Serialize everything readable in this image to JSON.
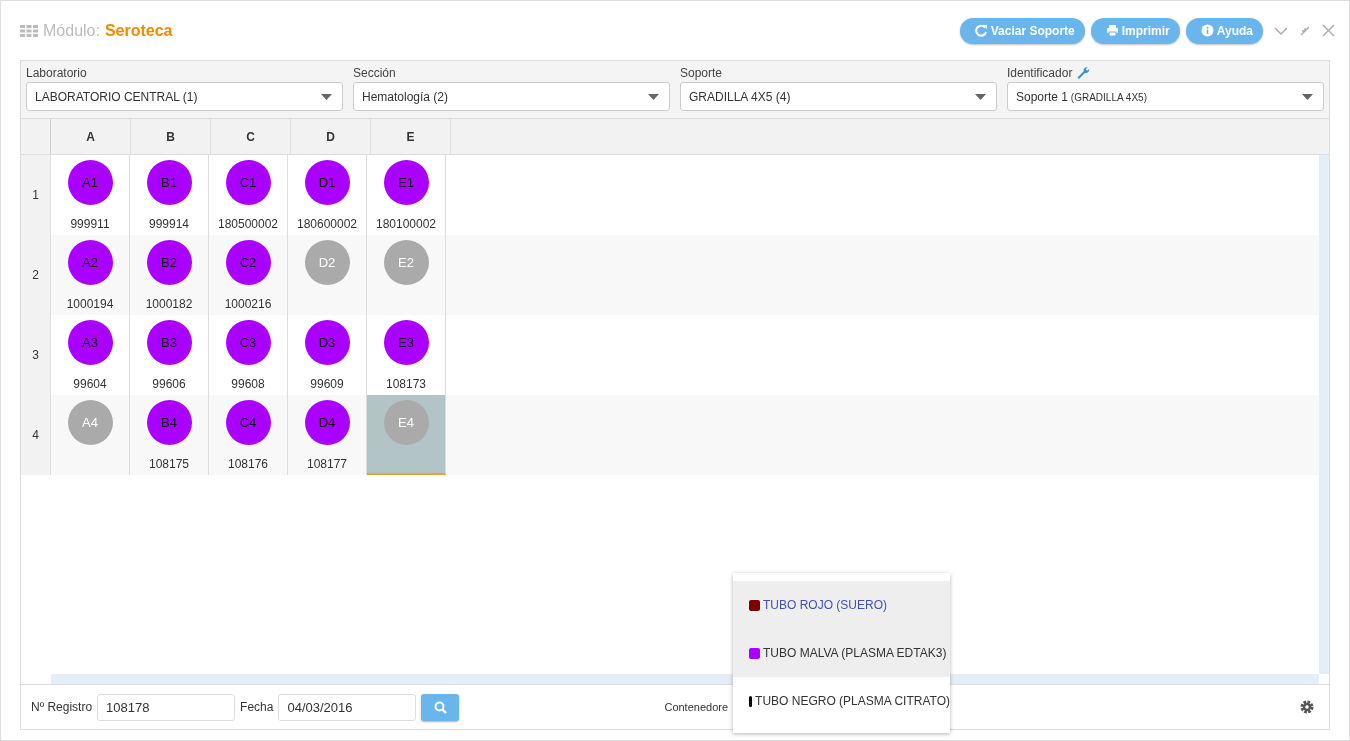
{
  "header": {
    "module_label": "Módulo:",
    "module_name": "Seroteca",
    "buttons": [
      {
        "kind": "refresh",
        "label": "Vaciar Soporte"
      },
      {
        "kind": "print",
        "label": "Imprimir"
      },
      {
        "kind": "info",
        "label": "Ayuda"
      }
    ]
  },
  "filters": [
    {
      "label": "Laboratorio",
      "value": "LABORATORIO CENTRAL (1)",
      "tool": false
    },
    {
      "label": "Sección",
      "value": "Hematología (2)",
      "tool": false
    },
    {
      "label": "Soporte",
      "value": "GRADILLA 4X5 (4)",
      "tool": false
    },
    {
      "label": "Identificador",
      "value": "Soporte 1",
      "value_note": "(GRADILLA 4X5)",
      "tool": true
    }
  ],
  "grid": {
    "columns": [
      "A",
      "B",
      "C",
      "D",
      "E"
    ],
    "rows": [
      {
        "label": "1",
        "cells": [
          {
            "well": "A1",
            "code": "999911",
            "occupied": true,
            "selected": false
          },
          {
            "well": "B1",
            "code": "999914",
            "occupied": true,
            "selected": false
          },
          {
            "well": "C1",
            "code": "180500002",
            "occupied": true,
            "selected": false
          },
          {
            "well": "D1",
            "code": "180600002",
            "occupied": true,
            "selected": false
          },
          {
            "well": "E1",
            "code": "180100002",
            "occupied": true,
            "selected": false
          }
        ]
      },
      {
        "label": "2",
        "cells": [
          {
            "well": "A2",
            "code": "1000194",
            "occupied": true,
            "selected": false
          },
          {
            "well": "B2",
            "code": "1000182",
            "occupied": true,
            "selected": false
          },
          {
            "well": "C2",
            "code": "1000216",
            "occupied": true,
            "selected": false
          },
          {
            "well": "D2",
            "occupied": false,
            "selected": false
          },
          {
            "well": "E2",
            "occupied": false,
            "selected": false
          }
        ]
      },
      {
        "label": "3",
        "cells": [
          {
            "well": "A3",
            "code": "99604",
            "occupied": true,
            "selected": false
          },
          {
            "well": "B3",
            "code": "99606",
            "occupied": true,
            "selected": false
          },
          {
            "well": "C3",
            "code": "99608",
            "occupied": true,
            "selected": false
          },
          {
            "well": "D3",
            "code": "99609",
            "occupied": true,
            "selected": false
          },
          {
            "well": "E3",
            "code": "108173",
            "occupied": true,
            "selected": false
          }
        ]
      },
      {
        "label": "4",
        "cells": [
          {
            "well": "A4",
            "occupied": false,
            "selected": false
          },
          {
            "well": "B4",
            "code": "108175",
            "occupied": true,
            "selected": false
          },
          {
            "well": "C4",
            "code": "108176",
            "occupied": true,
            "selected": false
          },
          {
            "well": "D4",
            "code": "108177",
            "occupied": true,
            "selected": false
          },
          {
            "well": "E4",
            "occupied": false,
            "selected": true
          }
        ]
      }
    ]
  },
  "footer": {
    "registro_label": "Nº Registro",
    "registro_value": "108178",
    "fecha_label": "Fecha",
    "fecha_value": "04/03/2016",
    "contenedores_label": "Contenedore"
  },
  "container_menu": [
    {
      "label": "TUBO ROJO (SUERO)",
      "color": "#7f0000",
      "selected": true,
      "highlighted": true
    },
    {
      "label": "TUBO MALVA (PLASMA EDTAK3)",
      "color": "#aa00ff",
      "selected": false,
      "highlighted": true
    },
    {
      "label": "TUBO NEGRO (PLASMA CITRATO)",
      "color": "#000000",
      "selected": false,
      "highlighted": false
    }
  ]
}
